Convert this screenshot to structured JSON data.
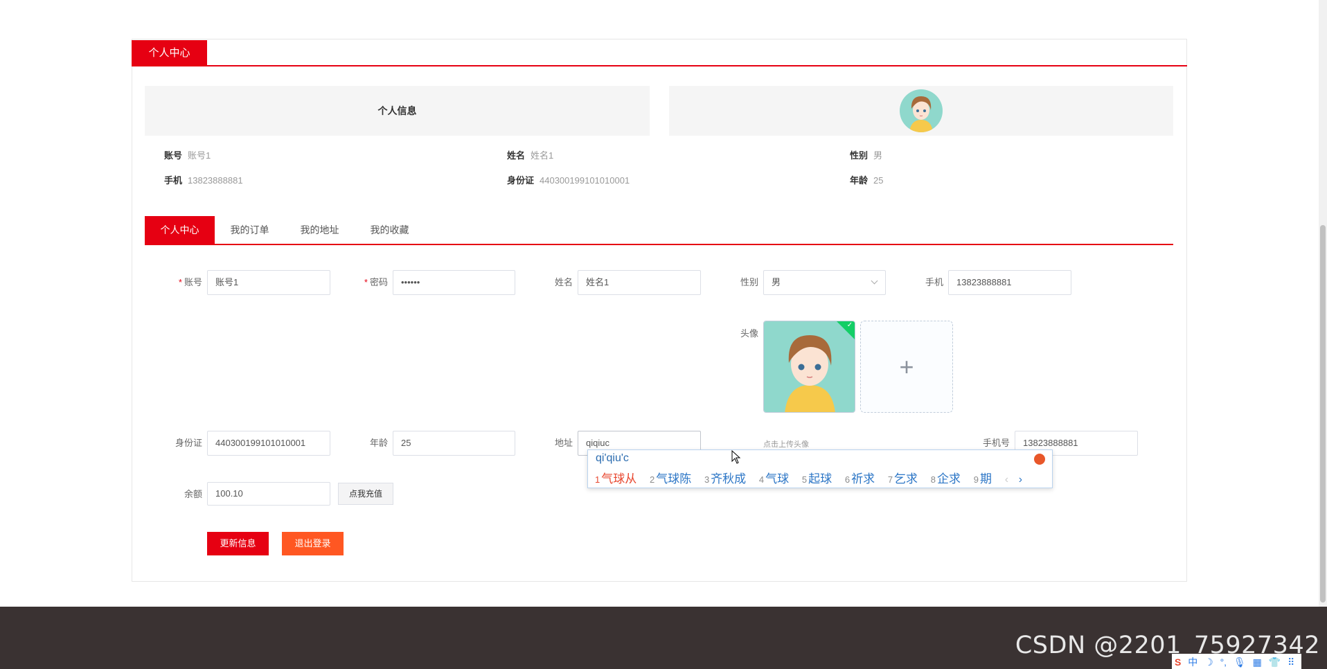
{
  "panel": {
    "title": "个人中心"
  },
  "info": {
    "title": "个人信息",
    "fields": [
      {
        "label": "账号",
        "value": "账号1"
      },
      {
        "label": "姓名",
        "value": "姓名1"
      },
      {
        "label": "性别",
        "value": "男"
      },
      {
        "label": "手机",
        "value": "13823888881"
      },
      {
        "label": "身份证",
        "value": "440300199101010001"
      },
      {
        "label": "年龄",
        "value": "25"
      }
    ]
  },
  "tabs": [
    "个人中心",
    "我的订单",
    "我的地址",
    "我的收藏"
  ],
  "form": {
    "account": {
      "label": "账号",
      "value": "账号1"
    },
    "password": {
      "label": "密码",
      "value": "••••••"
    },
    "name": {
      "label": "姓名",
      "value": "姓名1"
    },
    "gender": {
      "label": "性别",
      "value": "男"
    },
    "phone": {
      "label": "手机",
      "value": "13823888881"
    },
    "avatar": {
      "label": "头像",
      "tip": "点击上传头像"
    },
    "idcard": {
      "label": "身份证",
      "value": "440300199101010001"
    },
    "age": {
      "label": "年龄",
      "value": "25"
    },
    "address": {
      "label": "地址",
      "value": "qiqiuc"
    },
    "mobile": {
      "label": "手机号",
      "value": "13823888881"
    },
    "balance": {
      "label": "余额",
      "value": "100.10",
      "recharge_label": "点我充值"
    }
  },
  "buttons": {
    "update": "更新信息",
    "logout": "退出登录"
  },
  "ime": {
    "composition": "qi'qiu'c",
    "candidates": [
      {
        "n": "1",
        "text": "气球从"
      },
      {
        "n": "2",
        "text": "气球陈"
      },
      {
        "n": "3",
        "text": "齐秋成"
      },
      {
        "n": "4",
        "text": "气球"
      },
      {
        "n": "5",
        "text": "起球"
      },
      {
        "n": "6",
        "text": "祈求"
      },
      {
        "n": "7",
        "text": "乞求"
      },
      {
        "n": "8",
        "text": "企求"
      },
      {
        "n": "9",
        "text": "期"
      }
    ],
    "prev": "‹",
    "next": "›"
  },
  "watermark": "CSDN @2201_75927342",
  "tray": {
    "s": "S",
    "lang": "中",
    "moon": "☽",
    "dot": "°,",
    "mic": "🎙",
    "kbd": "▦",
    "shirt": "👕",
    "grid": "⠿"
  },
  "colors": {
    "accent": "#e60012",
    "logout": "#ff5722",
    "footer": "#3a3232"
  }
}
